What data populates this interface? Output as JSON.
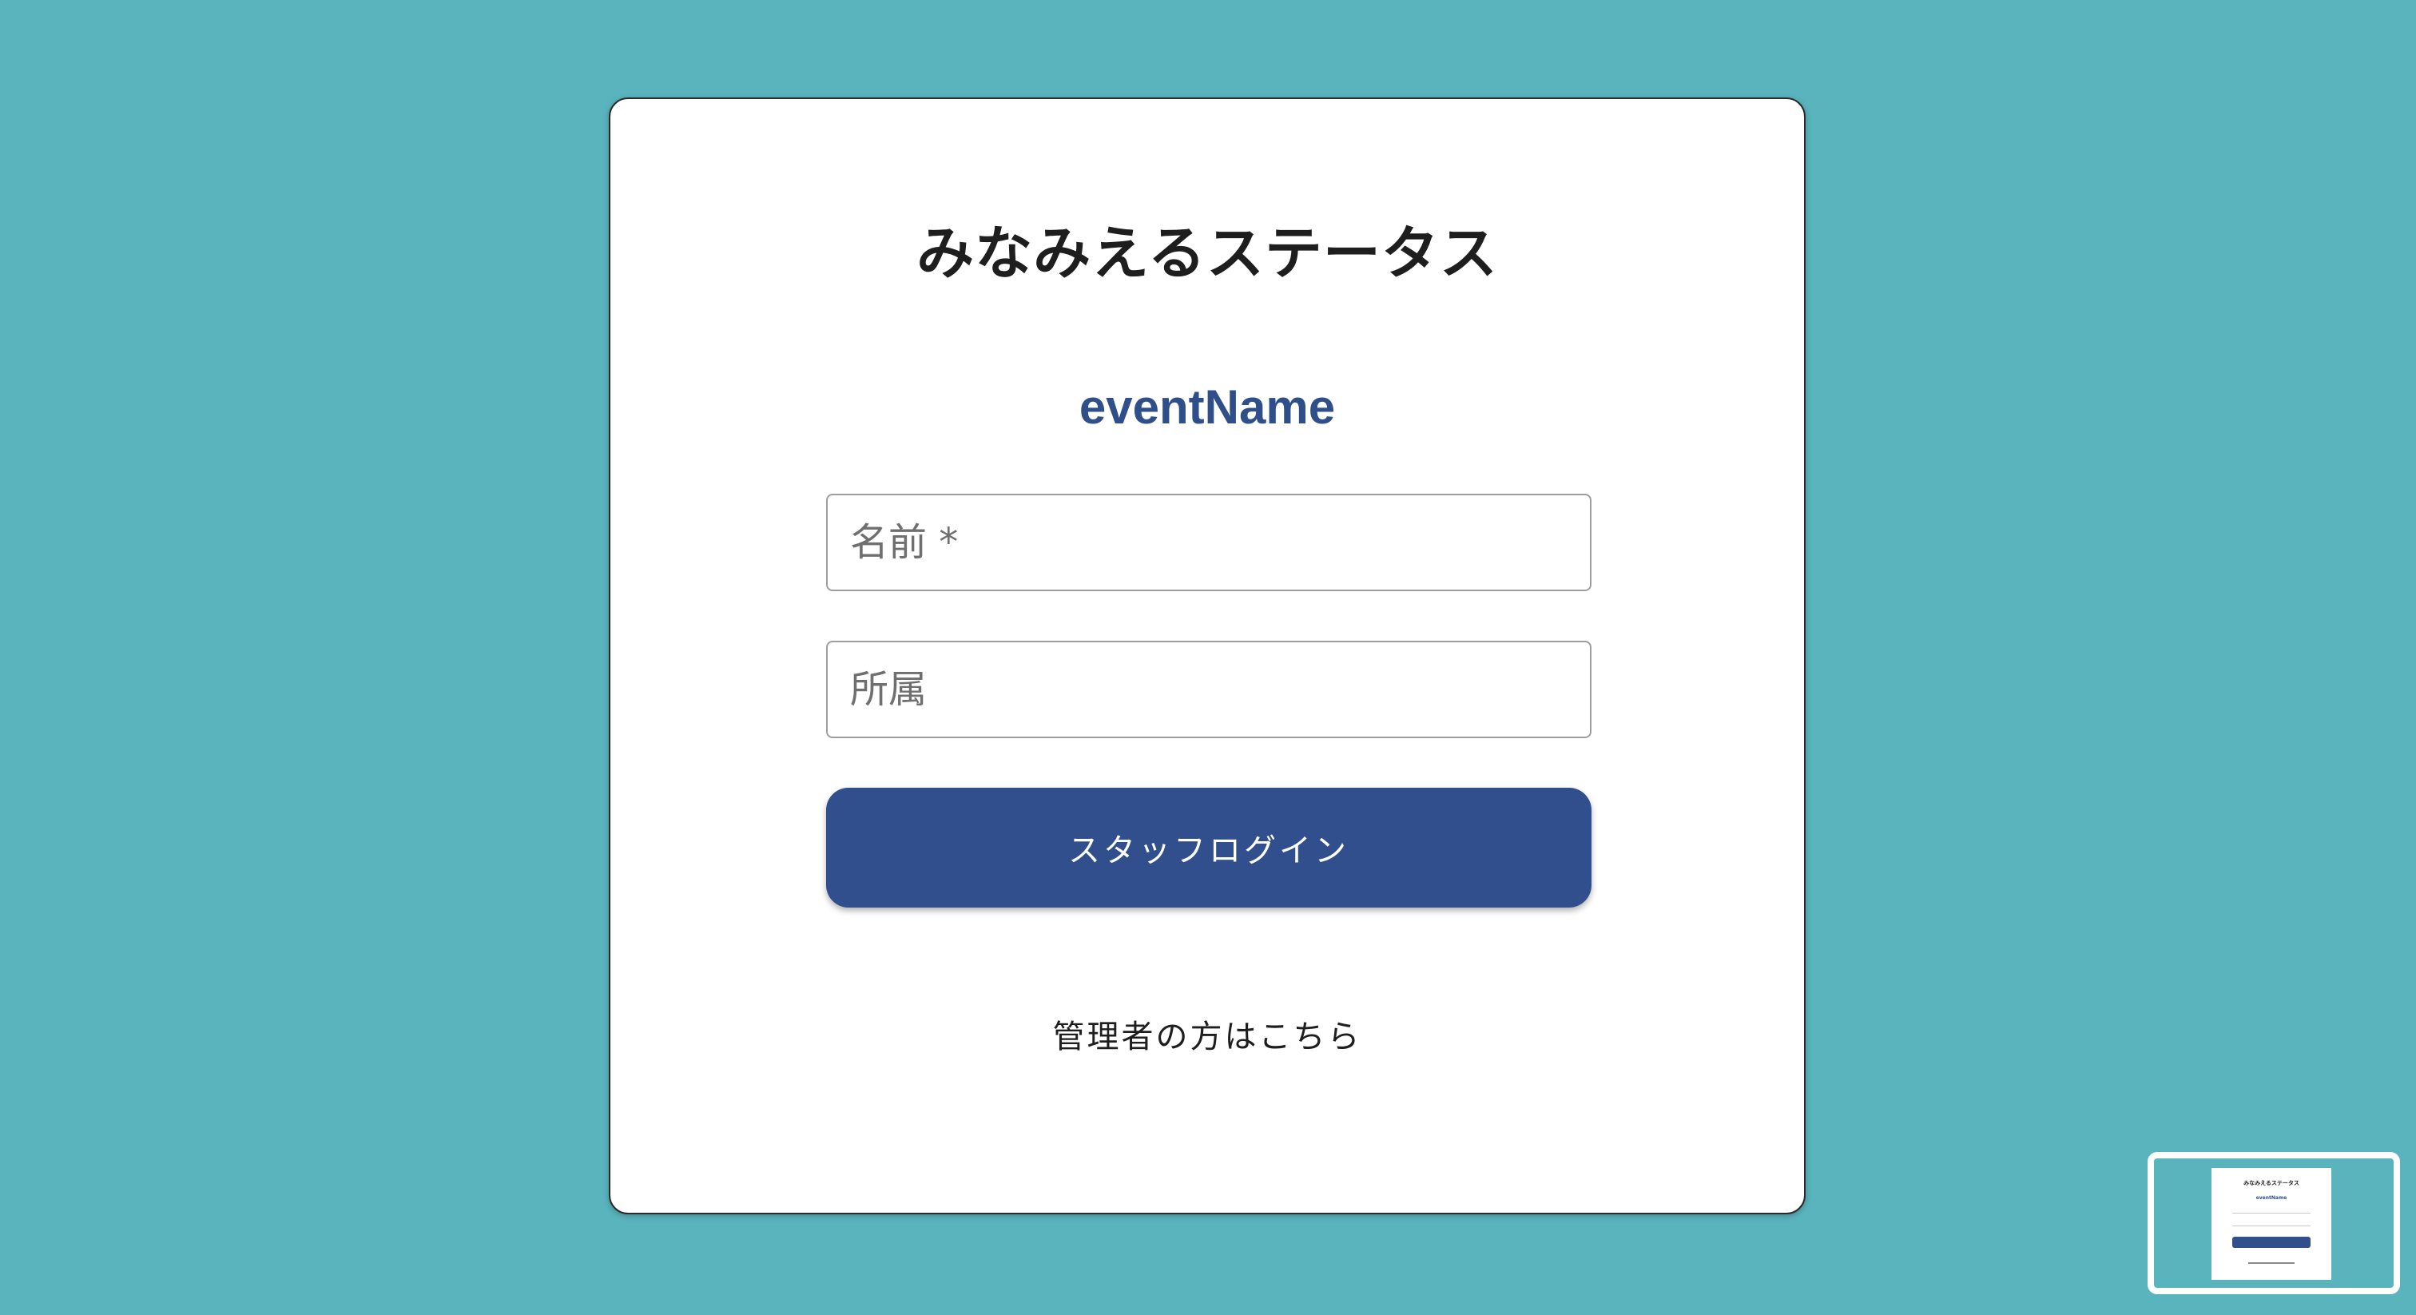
{
  "app": {
    "title": "みなみえるステータス",
    "event_name": "eventName"
  },
  "form": {
    "name_placeholder": "名前 *",
    "affiliation_placeholder": "所属",
    "login_label": "スタッフログイン"
  },
  "footer": {
    "admin_link": "管理者の方はこちら"
  },
  "colors": {
    "background": "#5ab4be",
    "primary": "#304f8c",
    "event_name": "#2f4f8b"
  }
}
